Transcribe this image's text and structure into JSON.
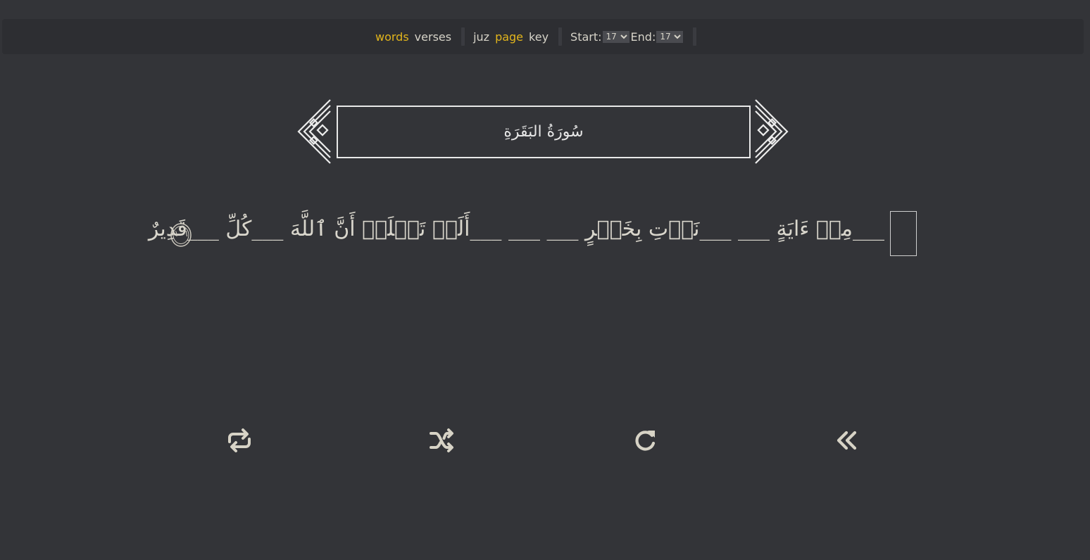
{
  "toolbar": {
    "words": "words",
    "verses": "verses",
    "juz": "juz",
    "page": "page",
    "key": "key",
    "start_label": "Start:",
    "start_value": "17",
    "end_label": "End:",
    "end_value": "17",
    "active_color": "#e2b51c"
  },
  "header": {
    "surah_name": "سُورَةُ البَقَرَةِ"
  },
  "verse": {
    "text": "___مِنۡ ءَايَةٍ ___ ___نَأۡتِ بِخَيۡرٍ ___ ___ ___أَلَمۡ تَعۡلَمۡ أَنَّ ٱللَّهَ ___كُلِّ ___قَدِيرٌ",
    "number": "١٠٦"
  },
  "controls": {
    "repeat": "repeat-icon",
    "shuffle": "shuffle-icon",
    "redo": "redo-icon",
    "back": "double-chevron-left-icon"
  }
}
